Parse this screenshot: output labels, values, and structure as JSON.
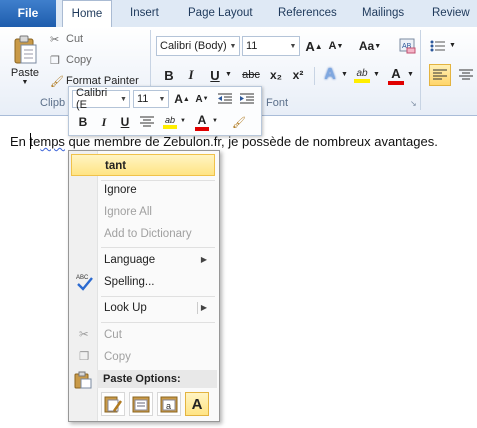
{
  "tabs": {
    "file": "File",
    "items": [
      "Home",
      "Insert",
      "Page Layout",
      "References",
      "Mailings",
      "Review"
    ]
  },
  "clipboard": {
    "paste": "Paste",
    "cut": "Cut",
    "copy": "Copy",
    "format_painter": "Format Painter",
    "group_label": "Clipb"
  },
  "font_group": {
    "font_name": "Calibri (Body)",
    "font_size": "11",
    "group_label": "Font",
    "bold": "B",
    "italic": "I",
    "underline": "U",
    "strike": "abc",
    "subscript": "x₂",
    "superscript": "x²",
    "grow": "A",
    "shrink": "A",
    "change_case": "Aa"
  },
  "mini_toolbar": {
    "font_name": "Calibri (E",
    "font_size": "11",
    "bold": "B",
    "italic": "I",
    "underline": "U"
  },
  "document": {
    "before": "En te",
    "misspelled": "mps",
    "after": " que membre de Zebulon.fr, je possède de nombreux avantages."
  },
  "context_menu": {
    "suggestion": "tant",
    "ignore": "Ignore",
    "ignore_all": "Ignore All",
    "add_to_dictionary": "Add to Dictionary",
    "language": "Language",
    "spelling": "Spelling...",
    "look_up": "Look Up",
    "cut": "Cut",
    "copy": "Copy",
    "paste_options": "Paste Options:",
    "paste_a": "A"
  },
  "colors": {
    "accent": "#2b579a",
    "file_tab": "#2a6ac0",
    "highlight": "#ffe484",
    "font_color": "#e00000"
  }
}
